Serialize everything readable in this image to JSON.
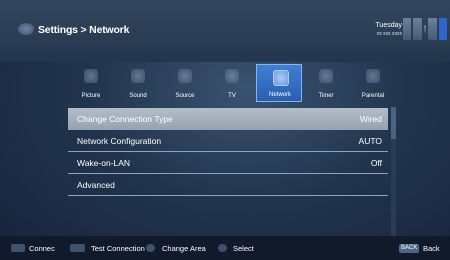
{
  "header": {
    "breadcrumb": "Settings > Network",
    "day": "Tuesday",
    "date": "xx xxx xxxx"
  },
  "tabs": [
    {
      "label": "Picture",
      "icon": "picture-icon"
    },
    {
      "label": "Sound",
      "icon": "sound-icon"
    },
    {
      "label": "Source",
      "icon": "source-icon"
    },
    {
      "label": "TV",
      "icon": "tv-icon"
    },
    {
      "label": "Network",
      "icon": "network-icon",
      "active": true
    },
    {
      "label": "Timer",
      "icon": "timer-icon"
    },
    {
      "label": "Parental",
      "icon": "parental-icon"
    }
  ],
  "settings": [
    {
      "label": "Change Connection Type",
      "value": "Wired",
      "selected": true
    },
    {
      "label": "Network Configuration",
      "value": "AUTO"
    },
    {
      "label": "Wake-on-LAN",
      "value": "Off"
    },
    {
      "label": "Advanced",
      "value": ""
    }
  ],
  "footer": {
    "connect": "Connec",
    "test_connection": "Test Connection",
    "change_area": "Change Area",
    "select": "Select",
    "back_key": "BACK",
    "back": "Back"
  },
  "colors": {
    "active_tab": "#3f7fd6",
    "selected_row": "#aab4c0",
    "background": "#22354e"
  }
}
